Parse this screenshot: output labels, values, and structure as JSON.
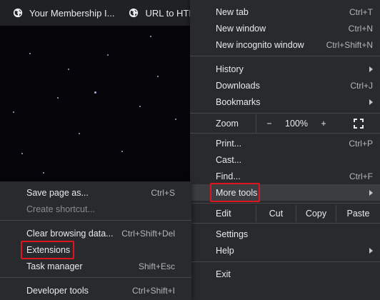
{
  "bookmarks": [
    {
      "label": "Your Membership I...",
      "icon": "globe-icon"
    },
    {
      "label": "URL to HTML",
      "icon": "globe-icon"
    }
  ],
  "main_menu": {
    "new_tab": {
      "label": "New tab",
      "shortcut": "Ctrl+T"
    },
    "new_window": {
      "label": "New window",
      "shortcut": "Ctrl+N"
    },
    "new_incognito": {
      "label": "New incognito window",
      "shortcut": "Ctrl+Shift+N"
    },
    "history": {
      "label": "History"
    },
    "downloads": {
      "label": "Downloads",
      "shortcut": "Ctrl+J"
    },
    "bookmarks": {
      "label": "Bookmarks"
    },
    "zoom": {
      "label": "Zoom",
      "minus": "−",
      "value": "100%",
      "plus": "+"
    },
    "print": {
      "label": "Print...",
      "shortcut": "Ctrl+P"
    },
    "cast": {
      "label": "Cast..."
    },
    "find": {
      "label": "Find...",
      "shortcut": "Ctrl+F"
    },
    "more_tools": {
      "label": "More tools"
    },
    "edit": {
      "label": "Edit",
      "cut": "Cut",
      "copy": "Copy",
      "paste": "Paste"
    },
    "settings": {
      "label": "Settings"
    },
    "help": {
      "label": "Help"
    },
    "exit": {
      "label": "Exit"
    }
  },
  "sub_menu": {
    "save_page": {
      "label": "Save page as...",
      "shortcut": "Ctrl+S"
    },
    "create_shortcut": {
      "label": "Create shortcut..."
    },
    "clear_browsing": {
      "label": "Clear browsing data...",
      "shortcut": "Ctrl+Shift+Del"
    },
    "extensions": {
      "label": "Extensions"
    },
    "task_manager": {
      "label": "Task manager",
      "shortcut": "Shift+Esc"
    },
    "developer_tools": {
      "label": "Developer tools",
      "shortcut": "Ctrl+Shift+I"
    }
  },
  "colors": {
    "menu_bg": "#292a2d",
    "highlight_outline": "#e0141e",
    "bookmarks_bar_bg": "#202124"
  }
}
